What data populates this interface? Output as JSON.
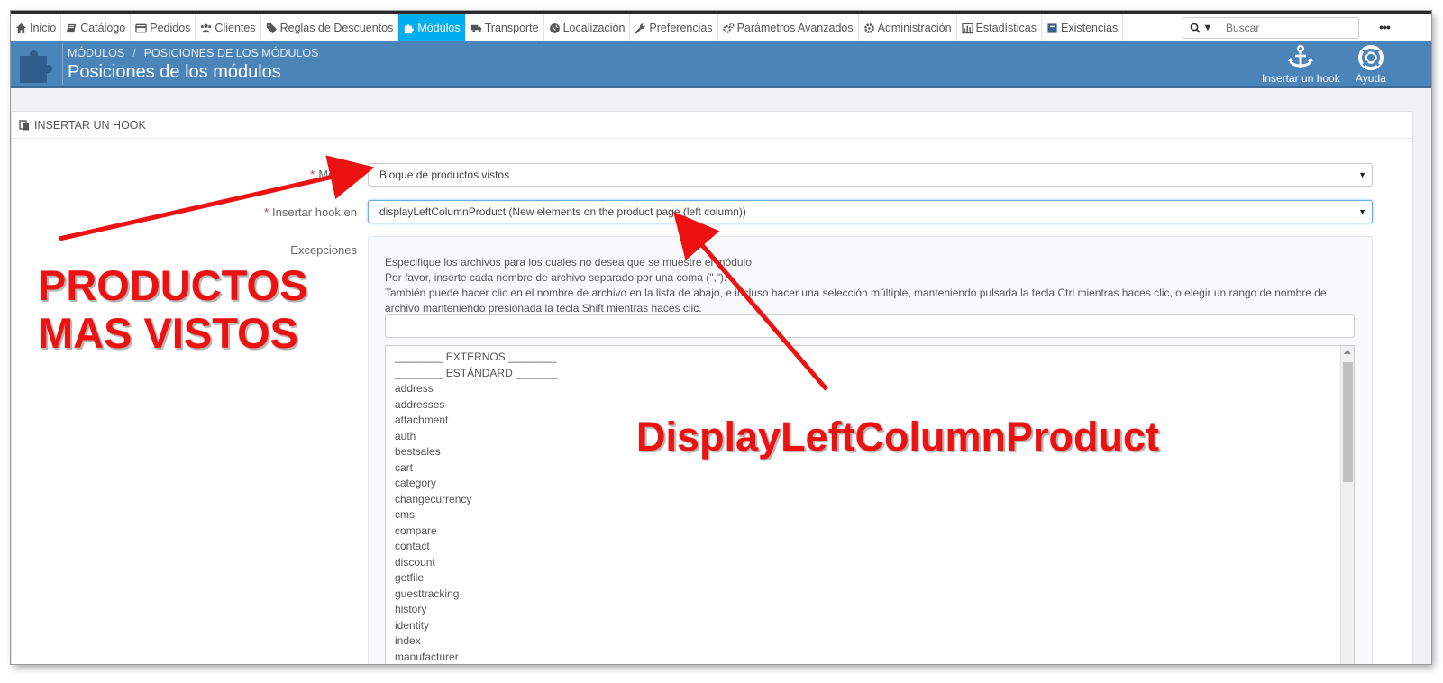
{
  "topnav": {
    "items": [
      {
        "label": "Inicio",
        "icon": "home-icon"
      },
      {
        "label": "Catálogo",
        "icon": "book-icon"
      },
      {
        "label": "Pedidos",
        "icon": "credit-card-icon"
      },
      {
        "label": "Clientes",
        "icon": "users-icon"
      },
      {
        "label": "Reglas de Descuentos",
        "icon": "tags-icon"
      },
      {
        "label": "Módulos",
        "icon": "puzzle-icon"
      },
      {
        "label": "Transporte",
        "icon": "truck-icon"
      },
      {
        "label": "Localización",
        "icon": "globe-icon"
      },
      {
        "label": "Preferencias",
        "icon": "wrench-icon"
      },
      {
        "label": "Parámetros Avanzados",
        "icon": "cogs-icon"
      },
      {
        "label": "Administración",
        "icon": "cog-icon"
      },
      {
        "label": "Estadísticas",
        "icon": "bar-chart-icon"
      },
      {
        "label": "Existencias",
        "icon": "archive-icon"
      }
    ],
    "active": "Módulos",
    "search_placeholder": "Buscar",
    "more_label": "•••"
  },
  "header": {
    "breadcrumb": [
      "MÓDULOS",
      "POSICIONES DE LOS MÓDULOS"
    ],
    "breadcrumb_sep": "/",
    "title": "Posiciones de los módulos",
    "buttons": {
      "insert_hook": "Insertar un hook",
      "help": "Ayuda"
    }
  },
  "panel": {
    "heading": "INSERTAR UN HOOK",
    "module_label": "Módulo",
    "module_value": "Bloque de productos vistos",
    "hook_label": "Insertar hook en",
    "hook_value": "displayLeftColumnProduct (New elements on the product page (left column))",
    "required_mark": "*",
    "exceptions_label": "Excepciones",
    "help_lines": [
      "Especifique los archivos para los cuales no desea que se muestre el módulo",
      "Por favor, inserte cada nombre de archivo separado por una coma (\",\").",
      "También puede hacer clic en el nombre de archivo en la lista de abajo, e incluso hacer una selección múltiple, manteniendo pulsada la tecla Ctrl mientras haces clic, o elegir un rango de nombre de archivo manteniendo presionada la tecla Shift mientras haces clic."
    ],
    "exception_files": [
      "________ EXTERNOS ________",
      "________ ESTÁNDARD _______",
      "address",
      "addresses",
      "attachment",
      "auth",
      "bestsales",
      "cart",
      "category",
      "changecurrency",
      "cms",
      "compare",
      "contact",
      "discount",
      "getfile",
      "guesttracking",
      "history",
      "identity",
      "index",
      "manufacturer"
    ]
  },
  "annotations": {
    "left_line1": "PRODUCTOS",
    "left_line2": "MAS VISTOS",
    "right": "DisplayLeftColumnProduct"
  },
  "colors": {
    "active_tab": "#00aff0",
    "header_bg": "#4b84b8",
    "annotation": "#ee1111"
  }
}
